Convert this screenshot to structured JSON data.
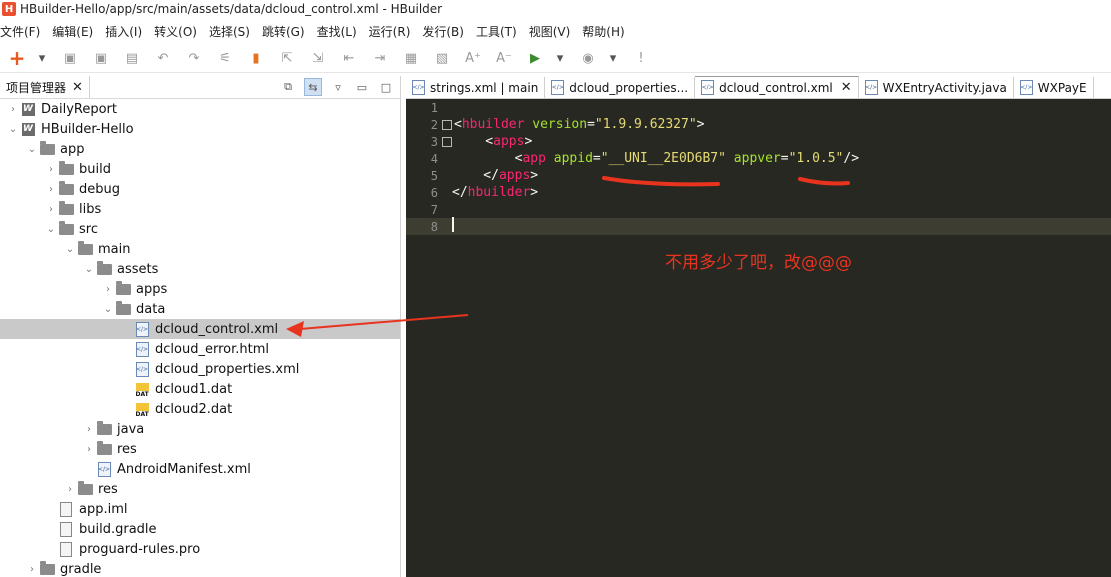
{
  "window": {
    "title": "HBuilder-Hello/app/src/main/assets/data/dcloud_control.xml  -  HBuilder",
    "app_icon": "H"
  },
  "menu": [
    {
      "label": "文件(F)"
    },
    {
      "label": "编辑(E)"
    },
    {
      "label": "插入(I)"
    },
    {
      "label": "转义(O)"
    },
    {
      "label": "选择(S)"
    },
    {
      "label": "跳转(G)"
    },
    {
      "label": "查找(L)"
    },
    {
      "label": "运行(R)"
    },
    {
      "label": "发行(B)"
    },
    {
      "label": "工具(T)"
    },
    {
      "label": "视图(V)"
    },
    {
      "label": "帮助(H)"
    }
  ],
  "toolbar": {
    "buttons": [
      {
        "name": "new-icon",
        "glyph": "+"
      },
      {
        "name": "dropdown-icon",
        "glyph": "▾"
      },
      {
        "name": "save-icon",
        "glyph": "▣"
      },
      {
        "name": "save-all-icon",
        "glyph": "▣"
      },
      {
        "name": "properties-icon",
        "glyph": "▤"
      },
      {
        "name": "undo-icon",
        "glyph": "↶"
      },
      {
        "name": "redo-icon",
        "glyph": "↷"
      },
      {
        "name": "format-icon",
        "glyph": "⚟"
      },
      {
        "name": "bookmark-icon",
        "glyph": "▮"
      },
      {
        "name": "goto-icon",
        "glyph": "⇱"
      },
      {
        "name": "export-icon",
        "glyph": "⇲"
      },
      {
        "name": "indent-left-icon",
        "glyph": "⇤"
      },
      {
        "name": "indent-right-icon",
        "glyph": "⇥"
      },
      {
        "name": "comment-icon",
        "glyph": "▦"
      },
      {
        "name": "uncomment-icon",
        "glyph": "▧"
      },
      {
        "name": "font-bigger-icon",
        "glyph": "A⁺"
      },
      {
        "name": "font-smaller-icon",
        "glyph": "A⁻"
      },
      {
        "name": "run-icon",
        "glyph": "▶"
      },
      {
        "name": "run-dropdown-icon",
        "glyph": "▾"
      },
      {
        "name": "browser-icon",
        "glyph": "◉"
      },
      {
        "name": "browser-dropdown-icon",
        "glyph": "▾"
      },
      {
        "name": "feedback-icon",
        "glyph": "!"
      }
    ]
  },
  "project_panel": {
    "title": "项目管理器",
    "tree": [
      {
        "label": "DailyReport",
        "depth": 0,
        "icon": "project",
        "expanded": false
      },
      {
        "label": "HBuilder-Hello",
        "depth": 0,
        "icon": "project",
        "expanded": true
      },
      {
        "label": "app",
        "depth": 1,
        "icon": "folder",
        "expanded": true
      },
      {
        "label": "build",
        "depth": 2,
        "icon": "folder",
        "expanded": false
      },
      {
        "label": "debug",
        "depth": 2,
        "icon": "folder",
        "expanded": false
      },
      {
        "label": "libs",
        "depth": 2,
        "icon": "folder",
        "expanded": false
      },
      {
        "label": "src",
        "depth": 2,
        "icon": "folder",
        "expanded": true
      },
      {
        "label": "main",
        "depth": 3,
        "icon": "folder",
        "expanded": true
      },
      {
        "label": "assets",
        "depth": 4,
        "icon": "folder",
        "expanded": true
      },
      {
        "label": "apps",
        "depth": 5,
        "icon": "folder",
        "expanded": false
      },
      {
        "label": "data",
        "depth": 5,
        "icon": "folder",
        "expanded": true
      },
      {
        "label": "dcloud_control.xml",
        "depth": 6,
        "icon": "xml",
        "selected": true
      },
      {
        "label": "dcloud_error.html",
        "depth": 6,
        "icon": "xml"
      },
      {
        "label": "dcloud_properties.xml",
        "depth": 6,
        "icon": "xml"
      },
      {
        "label": "dcloud1.dat",
        "depth": 6,
        "icon": "dat"
      },
      {
        "label": "dcloud2.dat",
        "depth": 6,
        "icon": "dat"
      },
      {
        "label": "java",
        "depth": 4,
        "icon": "folder",
        "expanded": false
      },
      {
        "label": "res",
        "depth": 4,
        "icon": "folder",
        "expanded": false
      },
      {
        "label": "AndroidManifest.xml",
        "depth": 4,
        "icon": "xml"
      },
      {
        "label": "res",
        "depth": 3,
        "icon": "folder",
        "expanded": false
      },
      {
        "label": "app.iml",
        "depth": 2,
        "icon": "file"
      },
      {
        "label": "build.gradle",
        "depth": 2,
        "icon": "file"
      },
      {
        "label": "proguard-rules.pro",
        "depth": 2,
        "icon": "file"
      },
      {
        "label": "gradle",
        "depth": 1,
        "icon": "folder",
        "expanded": false
      }
    ]
  },
  "editor": {
    "tabs": [
      {
        "label": "strings.xml | main",
        "active": false
      },
      {
        "label": "dcloud_properties...",
        "active": false
      },
      {
        "label": "dcloud_control.xml",
        "active": true
      },
      {
        "label": "WXEntryActivity.java",
        "active": false
      },
      {
        "label": "WXPayE",
        "active": false
      }
    ],
    "lines": [
      {
        "n": "1",
        "fold": false,
        "tokens": []
      },
      {
        "n": "2",
        "fold": true,
        "tokens": [
          [
            "punc",
            "<"
          ],
          [
            "tag",
            "hbuilder"
          ],
          [
            "punc",
            " "
          ],
          [
            "attr",
            "version"
          ],
          [
            "punc",
            "="
          ],
          [
            "str",
            "\"1.9.9.62327\""
          ],
          [
            "punc",
            ">"
          ]
        ]
      },
      {
        "n": "3",
        "fold": true,
        "tokens": [
          [
            "punc",
            "    <"
          ],
          [
            "tag",
            "apps"
          ],
          [
            "punc",
            ">"
          ]
        ]
      },
      {
        "n": "4",
        "fold": false,
        "tokens": [
          [
            "punc",
            "        <"
          ],
          [
            "tag",
            "app"
          ],
          [
            "punc",
            " "
          ],
          [
            "attr",
            "appid"
          ],
          [
            "punc",
            "="
          ],
          [
            "str",
            "\"__UNI__2E0D6B7\""
          ],
          [
            "punc",
            " "
          ],
          [
            "attr",
            "appver"
          ],
          [
            "punc",
            "="
          ],
          [
            "str",
            "\"1.0.5\""
          ],
          [
            "punc",
            "/>"
          ]
        ]
      },
      {
        "n": "5",
        "fold": false,
        "tokens": [
          [
            "punc",
            "    </"
          ],
          [
            "tag",
            "apps"
          ],
          [
            "punc",
            ">"
          ]
        ]
      },
      {
        "n": "6",
        "fold": false,
        "tokens": [
          [
            "punc",
            "</"
          ],
          [
            "tag",
            "hbuilder"
          ],
          [
            "punc",
            ">"
          ]
        ]
      },
      {
        "n": "7",
        "fold": false,
        "tokens": []
      },
      {
        "n": "8",
        "fold": false,
        "tokens": [],
        "current": true
      }
    ]
  },
  "annotation": {
    "text": "不用多少了吧，改@@@",
    "color": "#e8341f"
  },
  "colors": {
    "editor_bg": "#272822",
    "tag": "#f92672",
    "attr": "#a6e22e",
    "string": "#e6db74",
    "selection": "#c9c9c9"
  }
}
